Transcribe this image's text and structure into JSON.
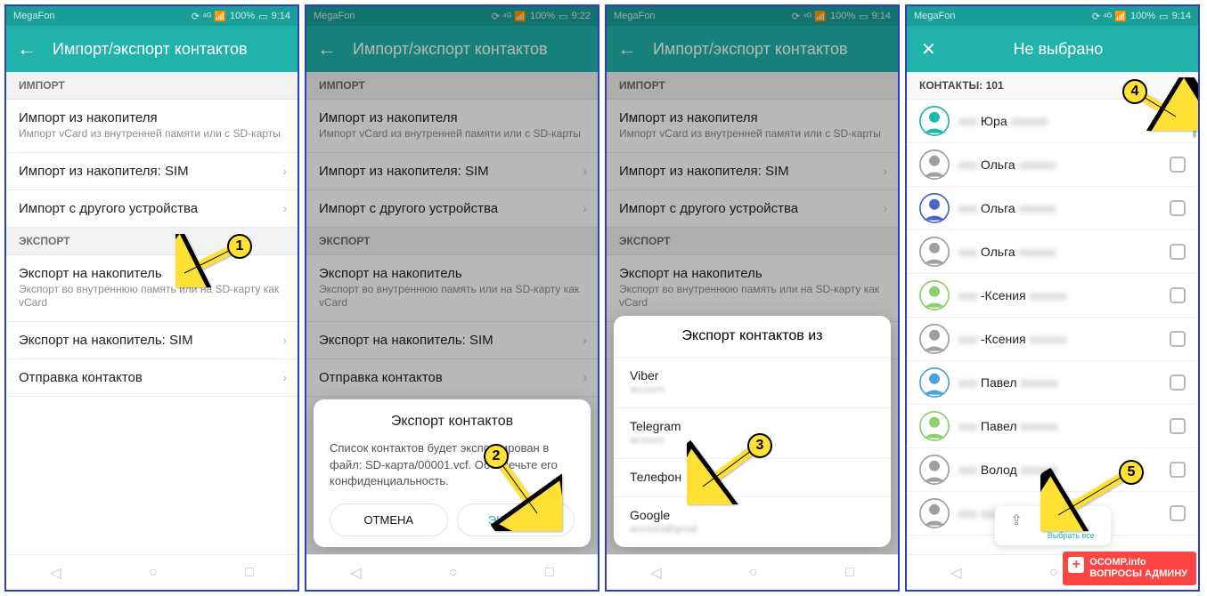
{
  "status": {
    "carrier": "MegaFon",
    "battery": "100%",
    "time1": "9:14",
    "time2": "9:22",
    "time3": "9:14",
    "time4": "9:14",
    "signal": "📶"
  },
  "screen1": {
    "title": "Импорт/экспорт контактов",
    "sec_import": "ИМПОРТ",
    "sec_export": "ЭКСПОРТ",
    "imp1": {
      "t": "Импорт из накопителя",
      "s": "Импорт vCard из внутренней памяти или с SD-карты"
    },
    "imp2": {
      "t": "Импорт из накопителя: SIM"
    },
    "imp3": {
      "t": "Импорт с другого устройства"
    },
    "exp1": {
      "t": "Экспорт на накопитель",
      "s": "Экспорт во внутреннюю память или на SD-карту как vCard"
    },
    "exp2": {
      "t": "Экспорт на накопитель: SIM"
    },
    "exp3": {
      "t": "Отправка контактов"
    }
  },
  "screen2": {
    "title": "Импорт/экспорт контактов",
    "dialog": {
      "title": "Экспорт контактов",
      "text": "Список контактов будет экспортирован в файл: SD-карта/00001.vcf. Обеспечьте его конфиденциальность.",
      "cancel": "ОТМЕНА",
      "ok": "ЭКСПОРТ"
    }
  },
  "screen3": {
    "title": "Импорт/экспорт контактов",
    "sheet": {
      "title": "Экспорт контактов из",
      "items": [
        {
          "name": "Viber"
        },
        {
          "name": "Telegram"
        },
        {
          "name": "Телефон"
        },
        {
          "name": "Google"
        }
      ]
    }
  },
  "screen4": {
    "title": "Не выбрано",
    "header": "КОНТАКТЫ: 101",
    "contacts": [
      {
        "name": "Юра",
        "color": "#1fb6ae"
      },
      {
        "name": "Ольга",
        "color": "#9f9f9f"
      },
      {
        "name": "Ольга",
        "color": "#4a64c9"
      },
      {
        "name": "Ольга",
        "color": "#9f9f9f"
      },
      {
        "name": "-Ксения",
        "color": "#8fcf6e"
      },
      {
        "name": "-Ксения",
        "color": "#9f9f9f"
      },
      {
        "name": "Павел",
        "color": "#4aa3de"
      },
      {
        "name": "Павел",
        "color": "#8fcf6e"
      },
      {
        "name": "Волод",
        "color": "#9f9f9f"
      },
      {
        "name": "",
        "color": "#9f9f9f"
      }
    ],
    "selectall": "Выбрать все"
  },
  "markers": {
    "m1": "1",
    "m2": "2",
    "m3": "3",
    "m4": "4",
    "m5": "5"
  },
  "watermark": {
    "line1": "OCOMP.info",
    "line2": "ВОПРОСЫ АДМИНУ"
  }
}
